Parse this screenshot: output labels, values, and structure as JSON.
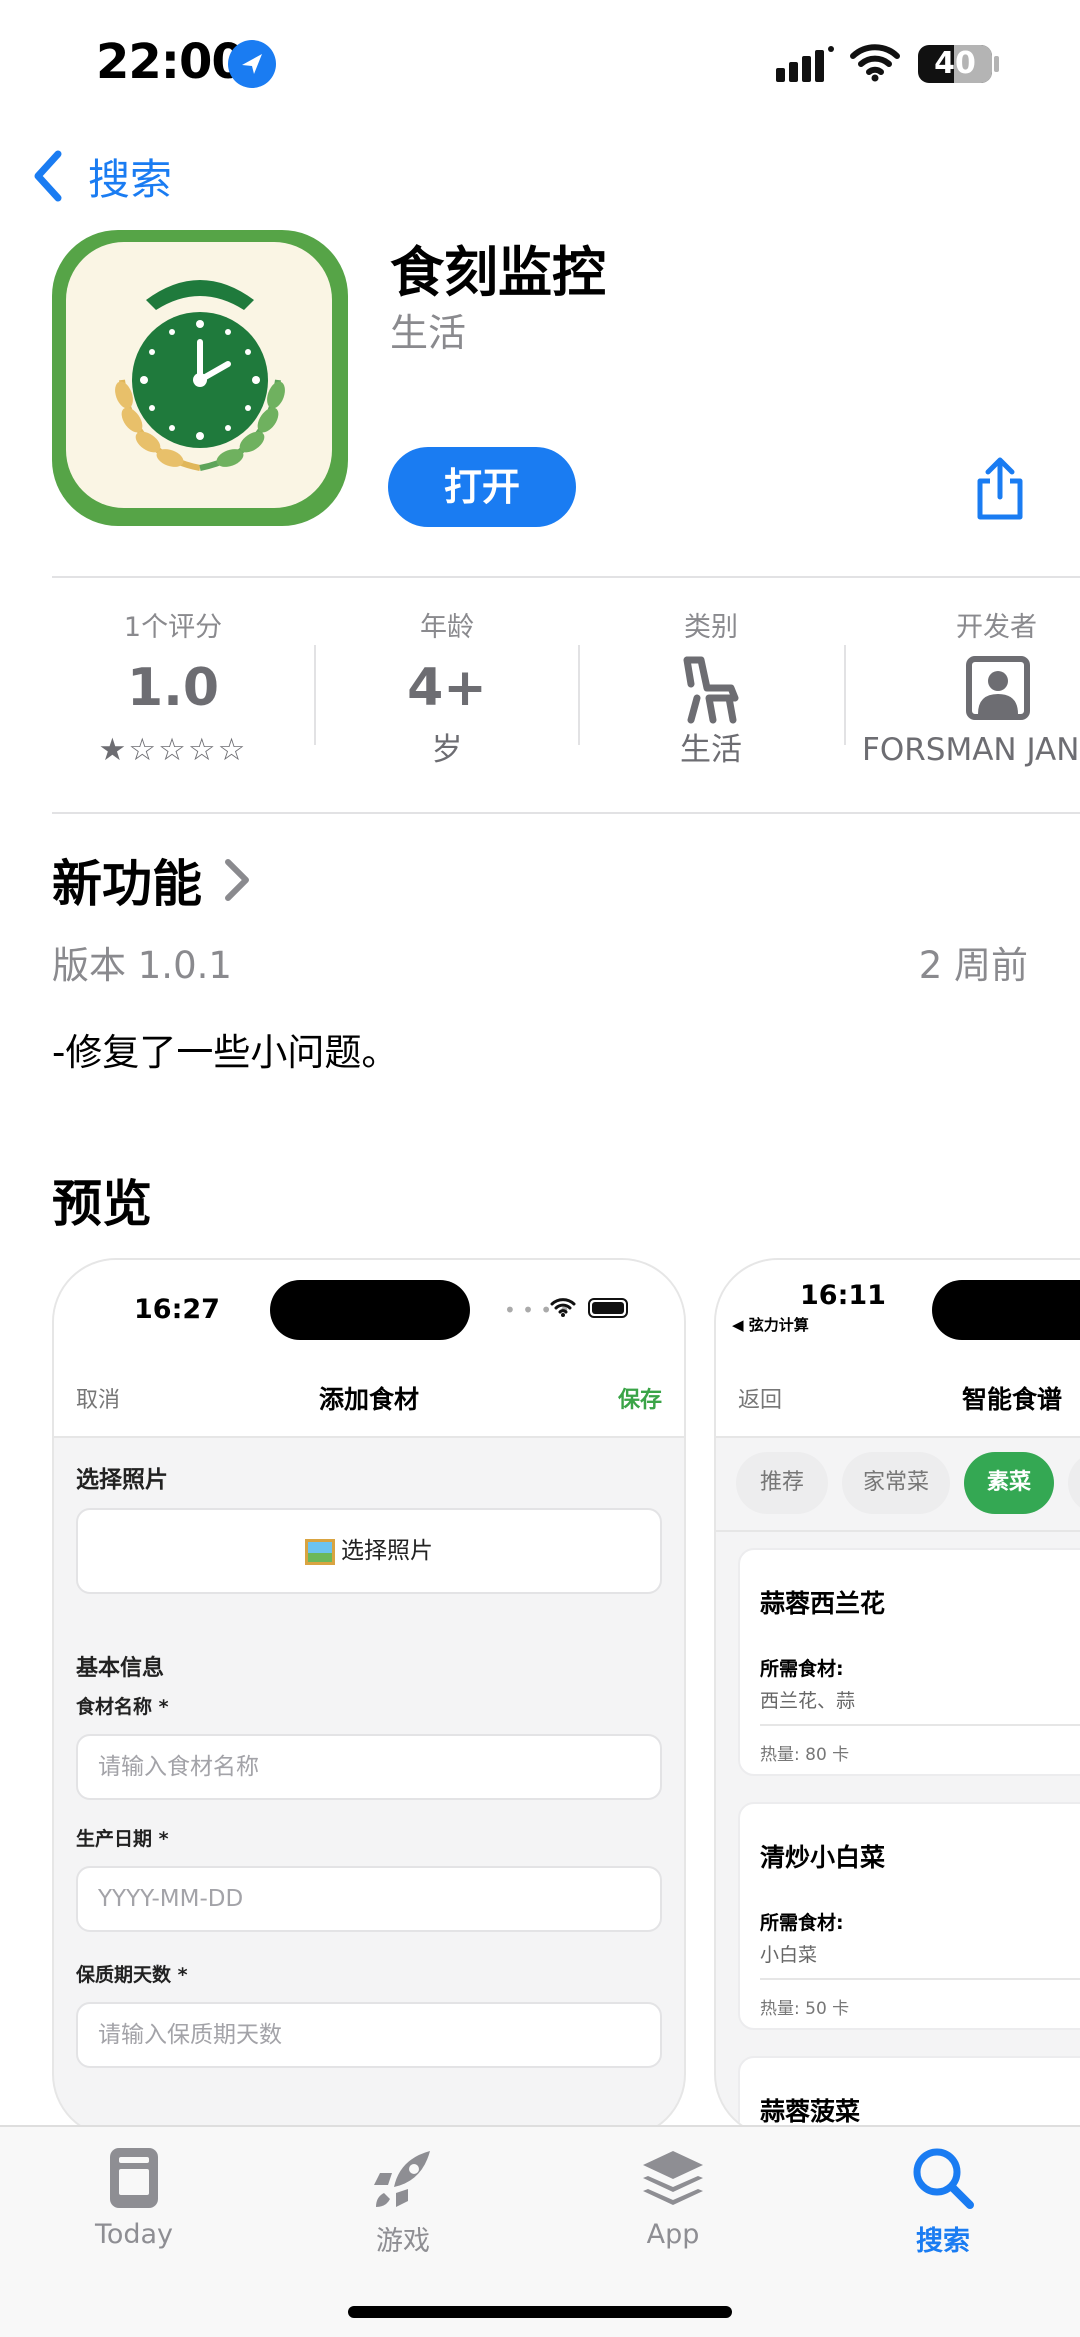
{
  "status_bar": {
    "time": "22:00",
    "battery": "40"
  },
  "nav": {
    "back_label": "搜索"
  },
  "app": {
    "name": "食刻监控",
    "category": "生活",
    "open_button": "打开"
  },
  "stats": [
    {
      "label": "1个评分",
      "value": "1.0",
      "rating": 1,
      "rating_max": 5
    },
    {
      "label": "年龄",
      "value": "4+",
      "sub": "岁"
    },
    {
      "label": "类别",
      "icon": "chair-icon",
      "sub": "生活"
    },
    {
      "label": "开发者",
      "icon": "person-icon",
      "sub": "FORSMAN JAN"
    }
  ],
  "whats_new": {
    "title": "新功能",
    "version": "版本 1.0.1",
    "when": "2 周前",
    "notes": "-修复了一些小问题。"
  },
  "preview": {
    "title": "预览",
    "shot1": {
      "time": "16:27",
      "cancel": "取消",
      "title": "添加食材",
      "save": "保存",
      "photo_section": "选择照片",
      "photo_button": "选择照片",
      "basic_info": "基本信息",
      "name_label": "食材名称 *",
      "name_placeholder": "请输入食材名称",
      "date_label": "生产日期 *",
      "date_placeholder": "YYYY-MM-DD",
      "shelf_label": "保质期天数 *",
      "shelf_placeholder": "请输入保质期天数"
    },
    "shot2": {
      "time": "16:11",
      "back_app": "◀ 弦力计算",
      "back": "返回",
      "title": "智能食谱",
      "chips": [
        "推荐",
        "家常菜",
        "素菜"
      ],
      "recipes": [
        {
          "name": "蒜蓉西兰花",
          "ing_label": "所需食材:",
          "ingredients": "西兰花、蒜",
          "calories": "热量: 80 卡"
        },
        {
          "name": "清炒小白菜",
          "ing_label": "所需食材:",
          "ingredients": "小白菜",
          "calories": "热量: 50 卡"
        },
        {
          "name": "蒜蓉菠菜"
        }
      ]
    }
  },
  "tab_bar": [
    {
      "label": "Today",
      "icon": "today-icon",
      "active": false
    },
    {
      "label": "游戏",
      "icon": "rocket-icon",
      "active": false
    },
    {
      "label": "App",
      "icon": "apps-stack-icon",
      "active": false
    },
    {
      "label": "搜索",
      "icon": "search-icon",
      "active": true
    }
  ],
  "colors": {
    "accent": "#1a7cf2",
    "app_green": "#1f7a3c",
    "chip_active": "#34a853"
  }
}
